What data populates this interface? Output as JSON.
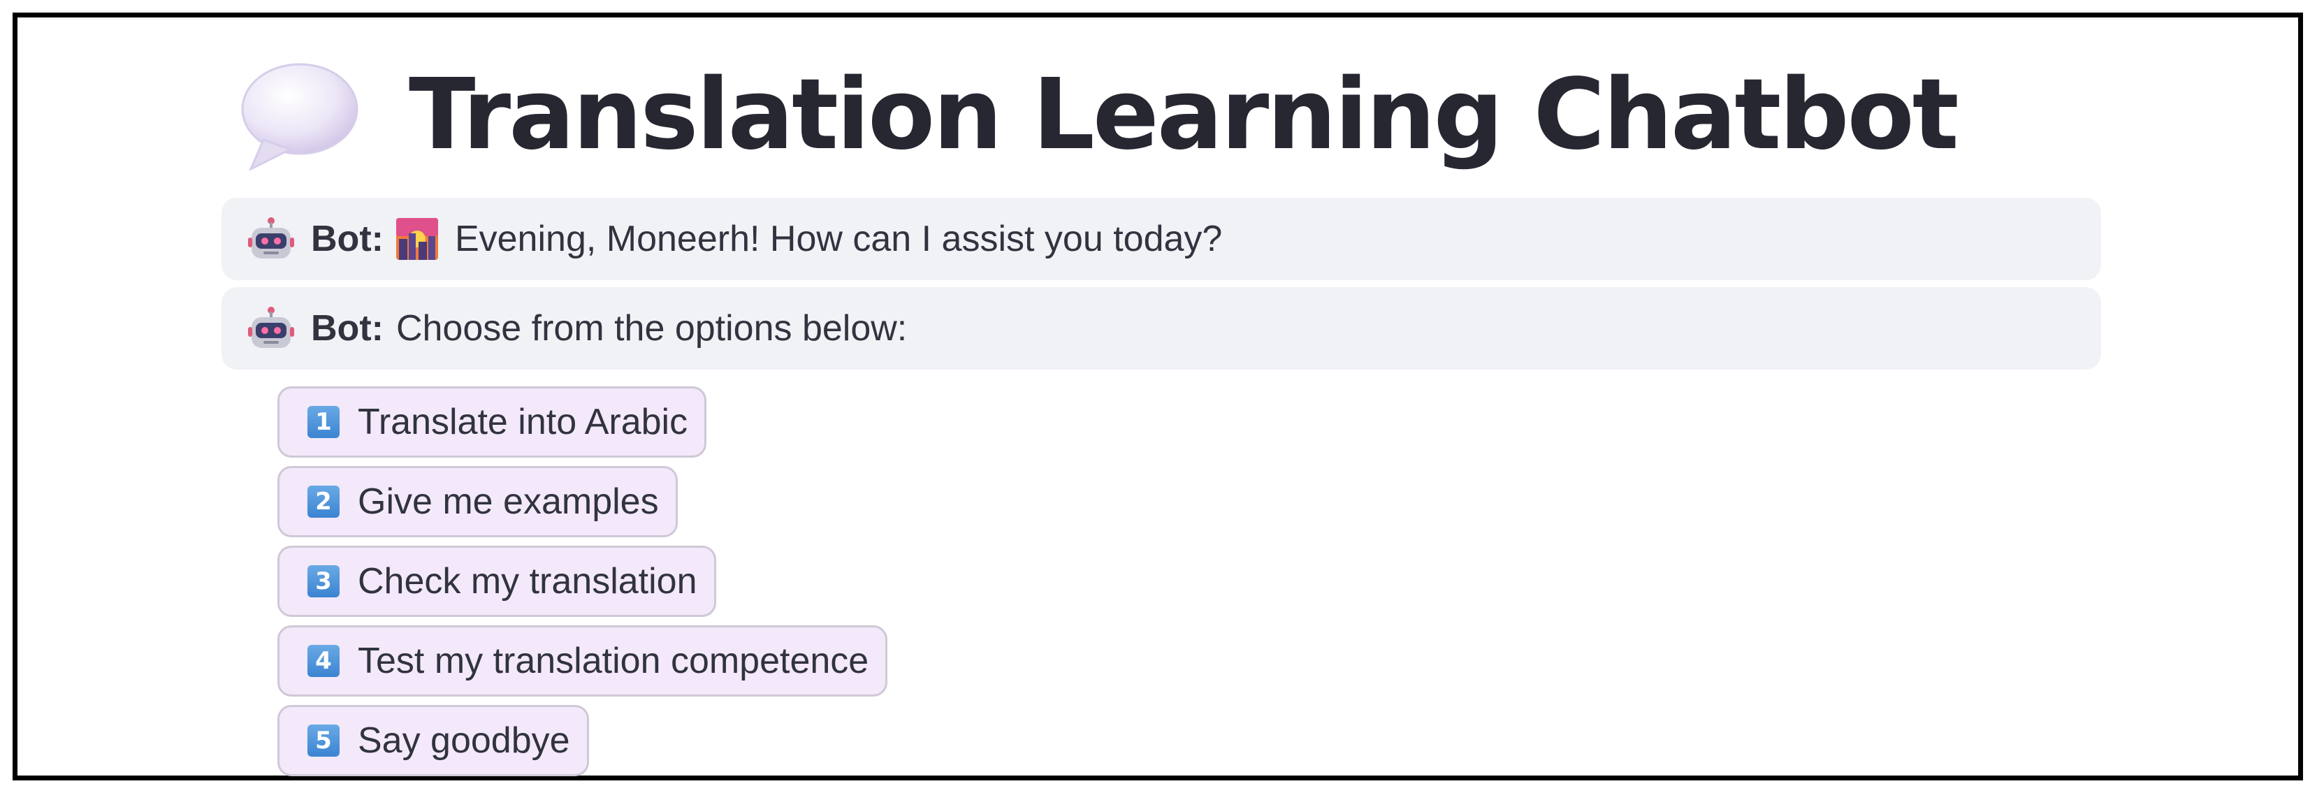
{
  "header": {
    "title": "Translation Learning Chatbot",
    "icon": "speech-balloon-icon"
  },
  "messages": [
    {
      "sender_label": "Bot:",
      "icon": "robot-icon",
      "emoji": "sunset-city-icon",
      "text": "Evening, Moneerh! How can I assist you today?"
    },
    {
      "sender_label": "Bot:",
      "icon": "robot-icon",
      "text": "Choose from the options below:"
    }
  ],
  "options": [
    {
      "number": "1",
      "label": "Translate into Arabic"
    },
    {
      "number": "2",
      "label": "Give me examples"
    },
    {
      "number": "3",
      "label": "Check my translation"
    },
    {
      "number": "4",
      "label": "Test my translation competence"
    },
    {
      "number": "5",
      "label": "Say goodbye"
    }
  ],
  "colors": {
    "bubble_bg": "#f0f2f6",
    "option_bg": "#f3e9fa",
    "option_border": "#cfc8d6",
    "title_text": "#262730",
    "badge_blue": "#3c84d1"
  }
}
